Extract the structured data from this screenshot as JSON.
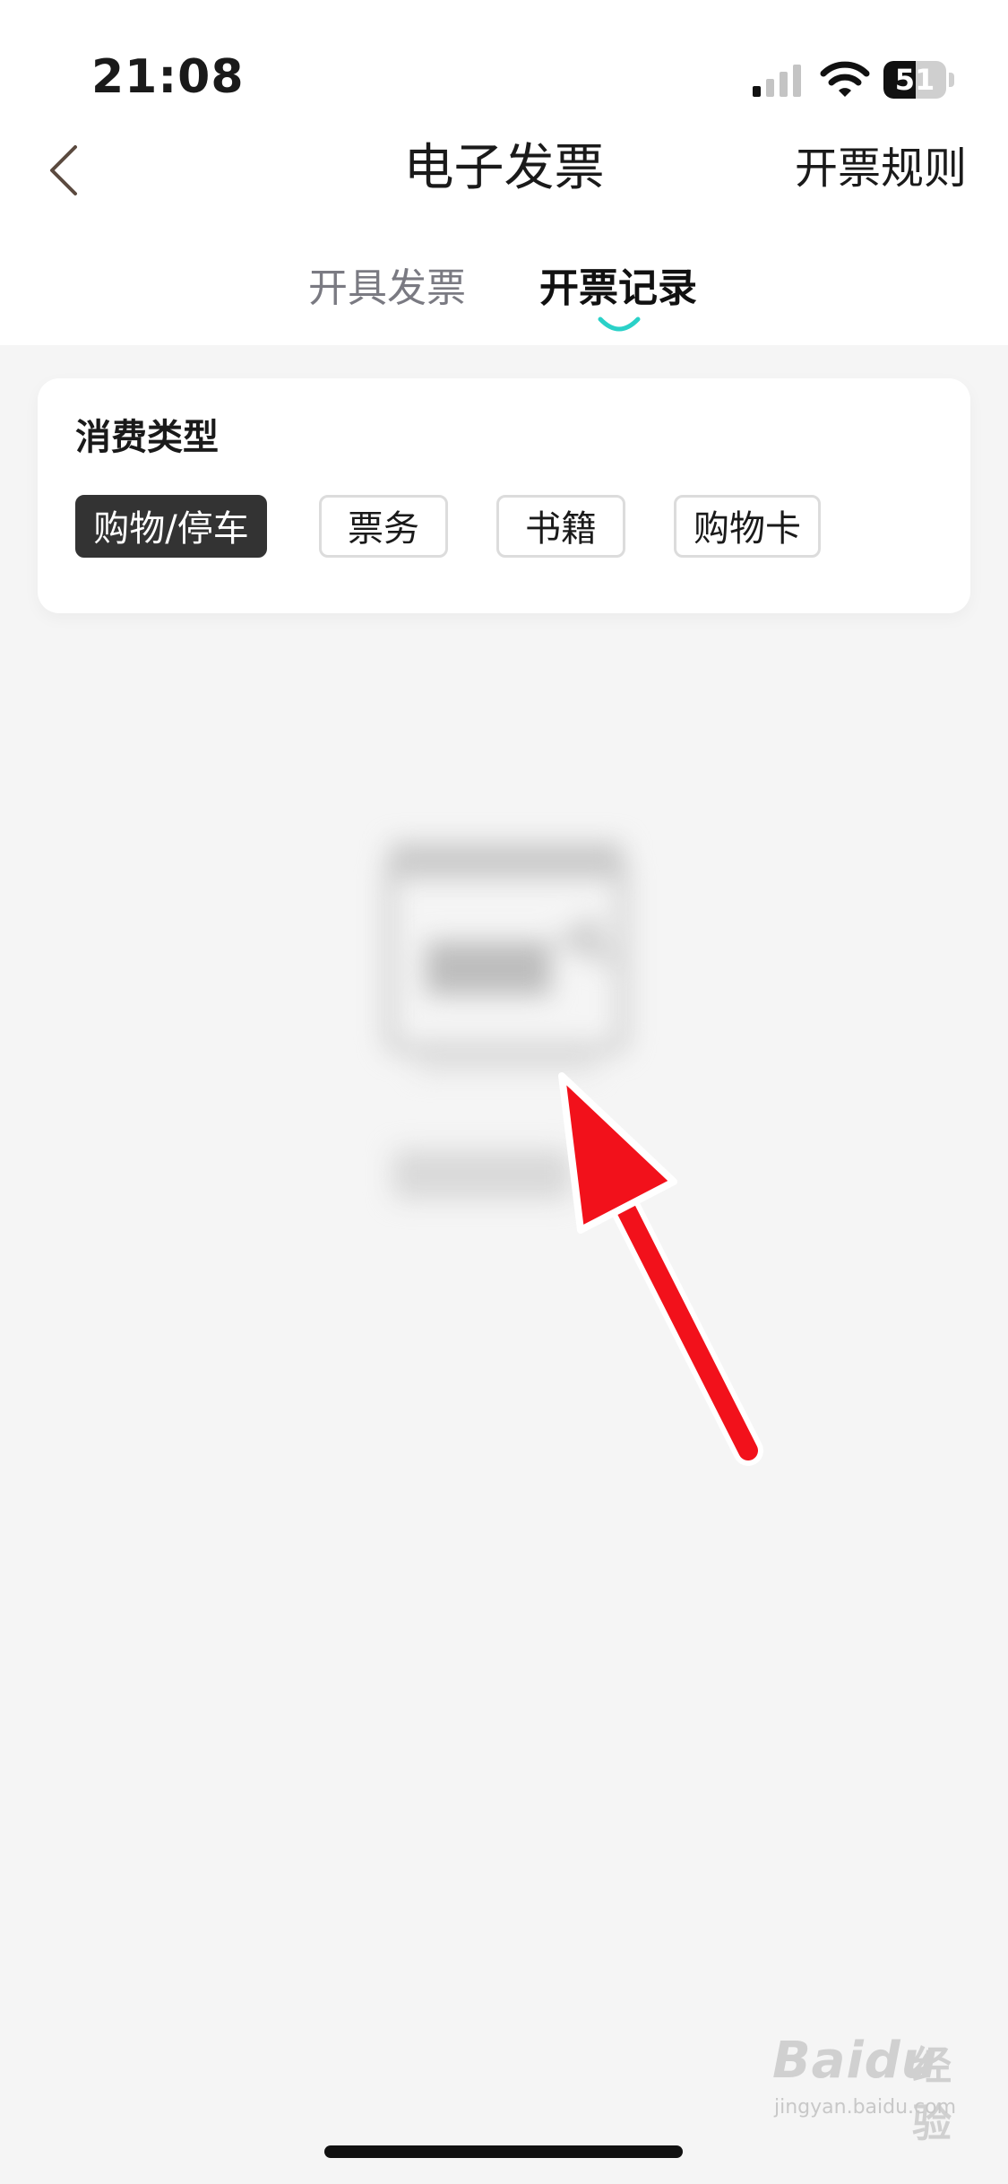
{
  "status_bar": {
    "time": "21:08",
    "battery": "51",
    "battery_level": 0.51
  },
  "header": {
    "title": "电子发票",
    "right_action": "开票规则"
  },
  "tabs": [
    {
      "label": "开具发票",
      "active": false
    },
    {
      "label": "开票记录",
      "active": true
    }
  ],
  "filter": {
    "title": "消费类型",
    "options": [
      {
        "label": "购物/停车",
        "selected": true
      },
      {
        "label": "票务",
        "selected": false
      },
      {
        "label": "书籍",
        "selected": false
      },
      {
        "label": "购物卡",
        "selected": false
      }
    ]
  },
  "colors": {
    "tab_indicator": "#2ad1c8",
    "arrow": "#f2111b",
    "chip_active": "#333333",
    "background": "#f5f5f5"
  },
  "icons": [
    "back-chevron-icon",
    "cellular-signal-icon",
    "wifi-icon",
    "battery-icon",
    "empty-state-icon"
  ],
  "watermark": {
    "brand": "Baidu",
    "cn": "经验",
    "url": "jingyan.baidu.com"
  }
}
